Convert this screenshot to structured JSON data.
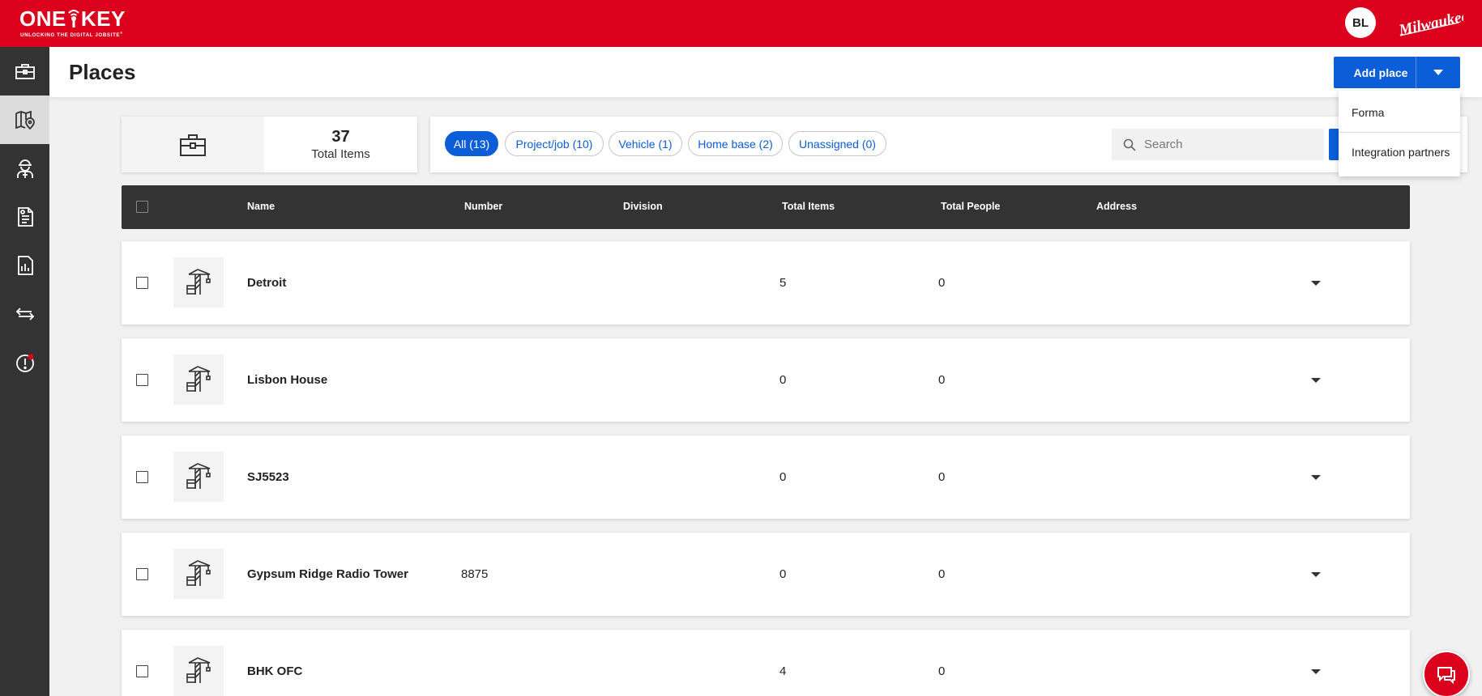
{
  "app": {
    "logo_text": "ONE KEY",
    "logo_tagline": "UNLOCKING THE DIGITAL JOBSITE",
    "user_initials": "BL",
    "brand_name": "Milwaukee",
    "brand_color": "#db011c",
    "accent_color": "#0b5ed7"
  },
  "sidebar": {
    "items": [
      {
        "icon": "toolbox-icon",
        "active": false
      },
      {
        "icon": "map-pin-icon",
        "active": true
      },
      {
        "icon": "worker-icon",
        "active": false
      },
      {
        "icon": "report-icon",
        "active": false
      },
      {
        "icon": "analytics-icon",
        "active": false
      },
      {
        "icon": "transfer-icon",
        "active": false
      },
      {
        "icon": "alert-icon",
        "active": false,
        "badge": true
      }
    ]
  },
  "header": {
    "title": "Places",
    "add_button": "Add place"
  },
  "dropdown": {
    "items": [
      "Forma",
      "Integration partners"
    ]
  },
  "summary": {
    "count": "37",
    "label": "Total Items"
  },
  "filters": {
    "chips": [
      {
        "label": "All (13)",
        "active": true
      },
      {
        "label": "Project/job (10)",
        "active": false
      },
      {
        "label": "Vehicle (1)",
        "active": false
      },
      {
        "label": "Home base (2)",
        "active": false
      },
      {
        "label": "Unassigned (0)",
        "active": false
      }
    ],
    "search_placeholder": "Search"
  },
  "table": {
    "columns": [
      "Name",
      "Number",
      "Division",
      "Total Items",
      "Total People",
      "Address"
    ],
    "rows": [
      {
        "name": "Detroit",
        "number": "",
        "division": "",
        "total_items": "5",
        "total_people": "0",
        "address": ""
      },
      {
        "name": "Lisbon House",
        "number": "",
        "division": "",
        "total_items": "0",
        "total_people": "0",
        "address": ""
      },
      {
        "name": "SJ5523",
        "number": "",
        "division": "",
        "total_items": "0",
        "total_people": "0",
        "address": ""
      },
      {
        "name": "Gypsum Ridge Radio Tower",
        "number": "8875",
        "division": "",
        "total_items": "0",
        "total_people": "0",
        "address": ""
      },
      {
        "name": "BHK OFC",
        "number": "",
        "division": "",
        "total_items": "4",
        "total_people": "0",
        "address": ""
      }
    ]
  }
}
